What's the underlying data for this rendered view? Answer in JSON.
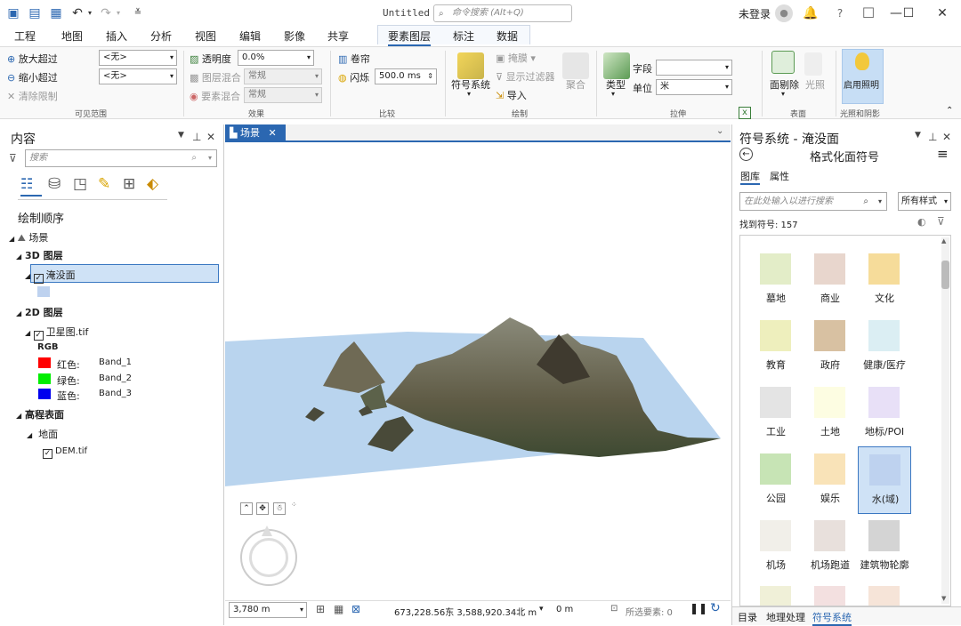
{
  "titlebar": {
    "title": "Untitled",
    "search_placeholder": "命令搜索 (Alt+Q)",
    "user": "未登录",
    "window_minimize": "—",
    "window_maximize": "☐",
    "window_close": "✕"
  },
  "menu": {
    "tabs": [
      "工程",
      "地图",
      "插入",
      "分析",
      "视图",
      "编辑",
      "影像",
      "共享",
      "要素图层",
      "标注",
      "数据"
    ]
  },
  "ribbon": {
    "visible_range": {
      "zoom_in": "放大超过",
      "zoom_out": "缩小超过",
      "clear": "清除限制",
      "zoom_in_value": "<无>",
      "zoom_out_value": "<无>",
      "group": "可见范围"
    },
    "effects": {
      "transparency": "透明度",
      "transparency_value": "0.0%",
      "layer_blend": "图层混合",
      "layer_blend_value": "常规",
      "feature_blend": "要素混合",
      "feature_blend_value": "常规",
      "group": "效果"
    },
    "compare": {
      "swipe": "卷帘",
      "flicker": "闪烁",
      "flicker_value": "500.0",
      "flicker_unit": "ms",
      "group": "比较"
    },
    "drawing": {
      "symbology": "符号系统",
      "mask": "掩膜",
      "show_filter": "显示过滤器",
      "import": "导入",
      "aggregate": "聚合",
      "group": "绘制"
    },
    "extrusion": {
      "type": "类型",
      "field": "字段",
      "unit": "单位",
      "unit_value": "米",
      "group": "拉伸"
    },
    "surface": {
      "face_culling": "面剔除",
      "lighting": "光照",
      "group": "表面"
    },
    "light_shadow": {
      "enable_lighting": "启用照明",
      "group": "光照和阴影"
    }
  },
  "contents": {
    "title": "内容",
    "search_placeholder": "搜索",
    "drawing_order": "绘制顺序",
    "scene": "场景",
    "layers3d": "3D 图层",
    "layer_flood": "淹没面",
    "layers2d": "2D 图层",
    "layer_sat": "卫星图.tif",
    "rgb": "RGB",
    "bands": [
      {
        "name": "红色:",
        "band": "Band_1",
        "color": "#ff0000"
      },
      {
        "name": "绿色:",
        "band": "Band_2",
        "color": "#00ee00"
      },
      {
        "name": "蓝色:",
        "band": "Band_3",
        "color": "#0000ee"
      }
    ],
    "elev": "高程表面",
    "ground": "地面",
    "dem": "DEM.tif"
  },
  "view": {
    "tab": "场景",
    "scale": "3,780 m",
    "coords": "673,228.56东  3,588,920.34北 m",
    "elev": "0 m",
    "selected": "所选要素: 0"
  },
  "symbology": {
    "title": "符号系统 - 淹没面",
    "subtitle": "格式化面符号",
    "tab_gallery": "图库",
    "tab_props": "属性",
    "search_placeholder": "在此处输入以进行搜索",
    "style_filter": "所有样式",
    "found": "找到符号: 157",
    "symbols": [
      {
        "name": "墓地",
        "color": "#e3edc8"
      },
      {
        "name": "商业",
        "color": "#e8d6cd"
      },
      {
        "name": "文化",
        "color": "#f6dc9a"
      },
      {
        "name": "教育",
        "color": "#eeefbd"
      },
      {
        "name": "政府",
        "color": "#d8c1a2"
      },
      {
        "name": "健康/医疗",
        "color": "#dbeef3"
      },
      {
        "name": "工业",
        "color": "#e4e4e4"
      },
      {
        "name": "土地",
        "color": "#fdfde2"
      },
      {
        "name": "地标/POI",
        "color": "#e8e0f7"
      },
      {
        "name": "公园",
        "color": "#c7e4b5"
      },
      {
        "name": "娱乐",
        "color": "#f9e3b8"
      },
      {
        "name": "水(域)",
        "color": "#bed2ef"
      },
      {
        "name": "机场",
        "color": "#f1efe9"
      },
      {
        "name": "机场跑道",
        "color": "#e8e0dc"
      },
      {
        "name": "建筑物轮廓",
        "color": "#d4d4d4"
      }
    ],
    "bottom_tabs": [
      "目录",
      "地理处理",
      "符号系统"
    ]
  }
}
